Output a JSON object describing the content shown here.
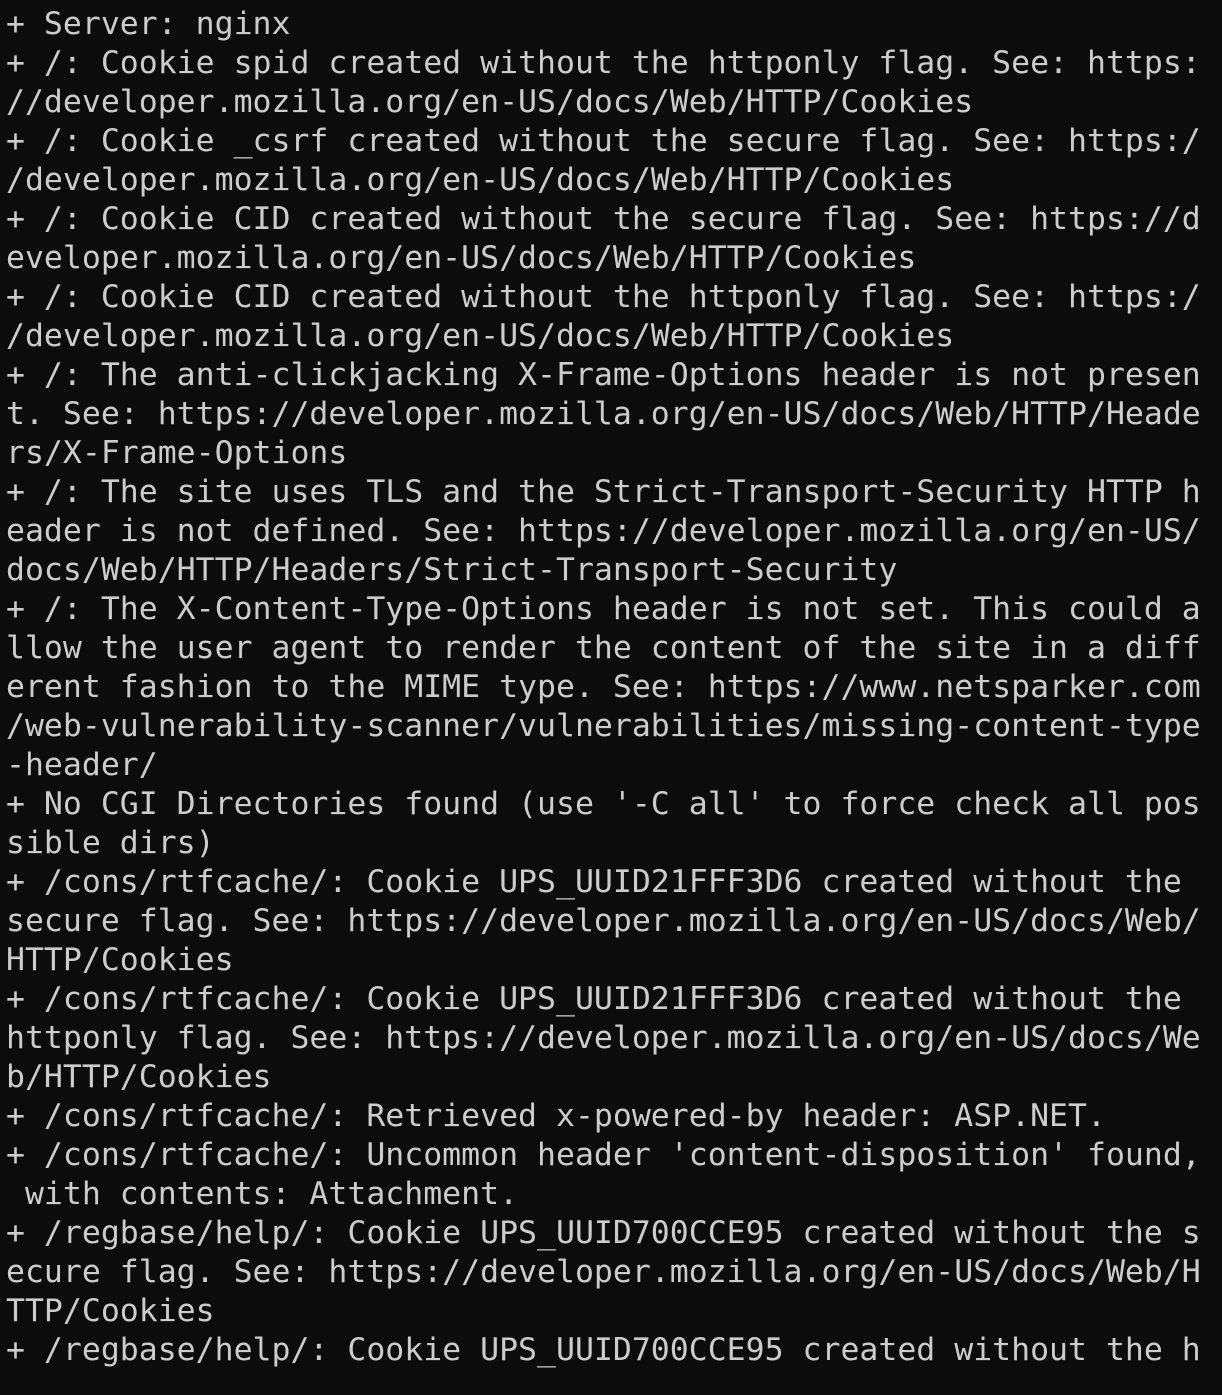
{
  "terminal": {
    "lines": [
      "+ Server: nginx",
      "+ /: Cookie spid created without the httponly flag. See: https:",
      "//developer.mozilla.org/en-US/docs/Web/HTTP/Cookies",
      "+ /: Cookie _csrf created without the secure flag. See: https:/",
      "/developer.mozilla.org/en-US/docs/Web/HTTP/Cookies",
      "+ /: Cookie CID created without the secure flag. See: https://d",
      "eveloper.mozilla.org/en-US/docs/Web/HTTP/Cookies",
      "+ /: Cookie CID created without the httponly flag. See: https:/",
      "/developer.mozilla.org/en-US/docs/Web/HTTP/Cookies",
      "+ /: The anti-clickjacking X-Frame-Options header is not presen",
      "t. See: https://developer.mozilla.org/en-US/docs/Web/HTTP/Heade",
      "rs/X-Frame-Options",
      "+ /: The site uses TLS and the Strict-Transport-Security HTTP h",
      "eader is not defined. See: https://developer.mozilla.org/en-US/",
      "docs/Web/HTTP/Headers/Strict-Transport-Security",
      "+ /: The X-Content-Type-Options header is not set. This could a",
      "llow the user agent to render the content of the site in a diff",
      "erent fashion to the MIME type. See: https://www.netsparker.com",
      "/web-vulnerability-scanner/vulnerabilities/missing-content-type",
      "-header/",
      "+ No CGI Directories found (use '-C all' to force check all pos",
      "sible dirs)",
      "+ /cons/rtfcache/: Cookie UPS_UUID21FFF3D6 created without the ",
      "secure flag. See: https://developer.mozilla.org/en-US/docs/Web/",
      "HTTP/Cookies",
      "+ /cons/rtfcache/: Cookie UPS_UUID21FFF3D6 created without the ",
      "httponly flag. See: https://developer.mozilla.org/en-US/docs/We",
      "b/HTTP/Cookies",
      "+ /cons/rtfcache/: Retrieved x-powered-by header: ASP.NET.",
      "+ /cons/rtfcache/: Uncommon header 'content-disposition' found,",
      " with contents: Attachment.",
      "+ /regbase/help/: Cookie UPS_UUID700CCE95 created without the s",
      "ecure flag. See: https://developer.mozilla.org/en-US/docs/Web/H",
      "TTP/Cookies",
      "+ /regbase/help/: Cookie UPS_UUID700CCE95 created without the h"
    ]
  },
  "colors": {
    "background": "#0c0c0c",
    "text": "#cccccc"
  }
}
